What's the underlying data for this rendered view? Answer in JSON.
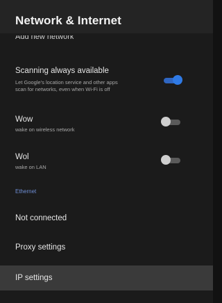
{
  "header": {
    "title": "Network & Internet"
  },
  "items": {
    "add_network": {
      "label": "Add new network"
    },
    "scanning": {
      "label": "Scanning always available",
      "desc_line1": "Let Google's location service and other apps",
      "desc_line2": "scan for networks, even when Wi-Fi is off",
      "toggle_on": true
    },
    "wow": {
      "label": "Wow",
      "desc": "wake on wireless network",
      "toggle_on": false
    },
    "wol": {
      "label": "Wol",
      "desc": "wake on LAN",
      "toggle_on": false
    }
  },
  "ethernet": {
    "section_title": "Ethernet",
    "status": "Not connected",
    "proxy": "Proxy settings",
    "ip": "IP settings"
  },
  "colors": {
    "accent": "#2f7ae5",
    "toggle_on_track": "#2f66c2",
    "toggle_off_knob": "#cfcfcf",
    "toggle_off_track": "#5a5a5a",
    "section": "#6f8fd6"
  }
}
